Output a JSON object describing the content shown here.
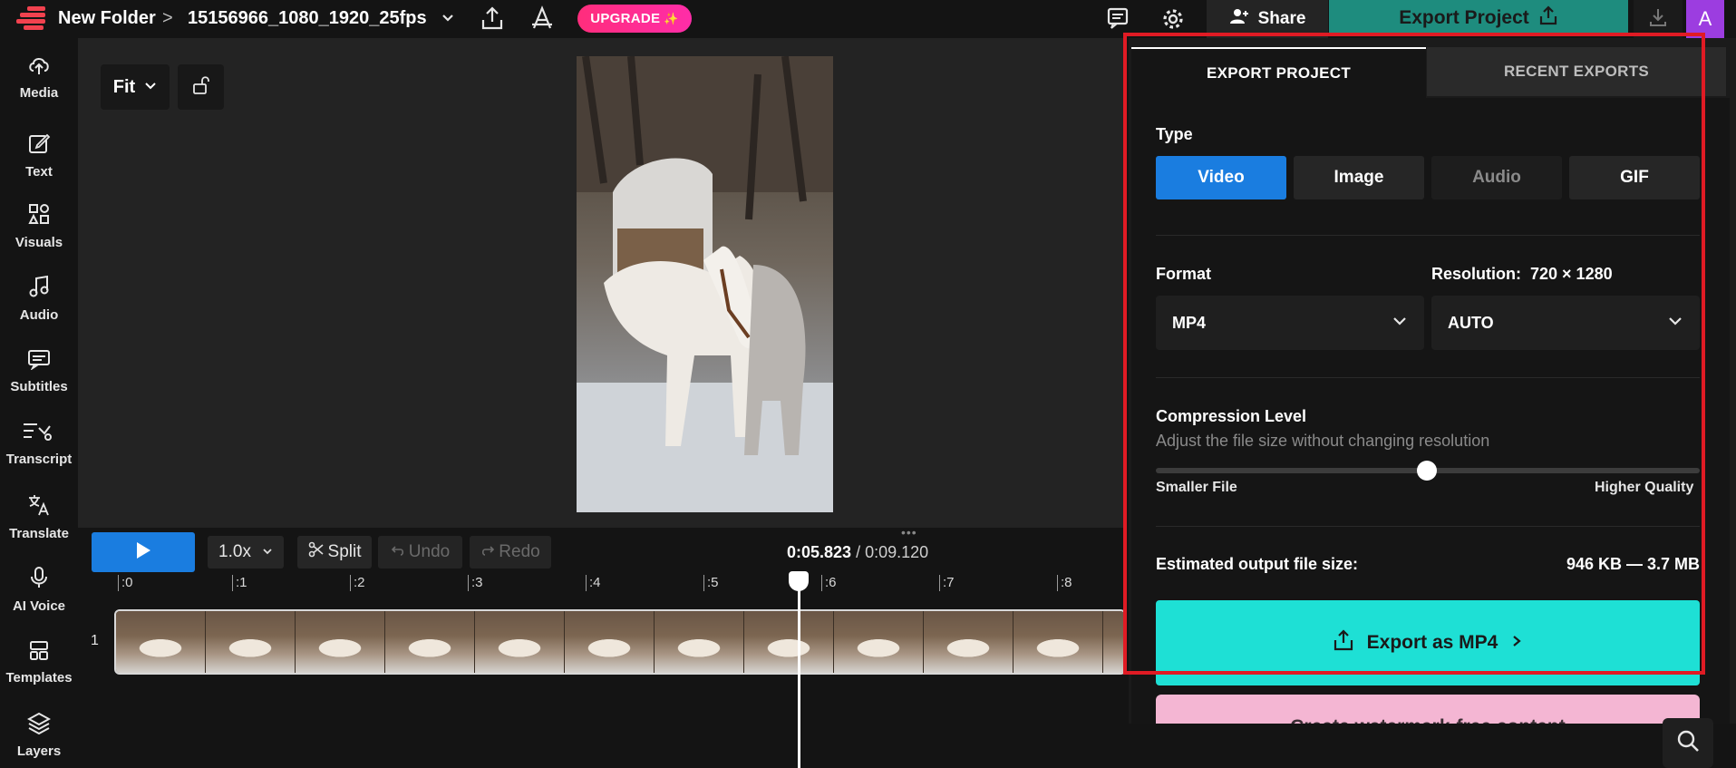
{
  "topbar": {
    "folder": "New Folder",
    "separator": ">",
    "project_name": "15156966_1080_1920_25fps",
    "upgrade_label": "UPGRADE",
    "upgrade_spark": "✨",
    "share_label": "Share",
    "export_label": "Export Project",
    "avatar_initial": "A"
  },
  "sidebar": {
    "items": [
      {
        "label": "Media",
        "icon": "cloud-upload-icon"
      },
      {
        "label": "Text",
        "icon": "edit-icon"
      },
      {
        "label": "Visuals",
        "icon": "shapes-icon"
      },
      {
        "label": "Audio",
        "icon": "music-icon"
      },
      {
        "label": "Subtitles",
        "icon": "subtitles-icon"
      },
      {
        "label": "Transcript",
        "icon": "transcript-icon"
      },
      {
        "label": "Translate",
        "icon": "translate-icon"
      },
      {
        "label": "AI Voice",
        "icon": "microphone-icon"
      },
      {
        "label": "Templates",
        "icon": "templates-icon"
      },
      {
        "label": "Layers",
        "icon": "layers-icon"
      }
    ]
  },
  "canvas": {
    "fit_label": "Fit"
  },
  "playback": {
    "speed": "1.0x",
    "split": "Split",
    "undo": "Undo",
    "redo": "Redo",
    "current_time": "0:05.823",
    "time_sep": " / ",
    "total_time": "0:09.120"
  },
  "timeline": {
    "ticks": [
      ":0",
      ":1",
      ":2",
      ":3",
      ":4",
      ":5",
      ":6",
      ":7",
      ":8"
    ],
    "track_number": "1"
  },
  "export_panel": {
    "tab_export": "EXPORT PROJECT",
    "tab_recent": "RECENT EXPORTS",
    "type_label": "Type",
    "types": [
      {
        "label": "Video",
        "selected": true
      },
      {
        "label": "Image",
        "selected": false
      },
      {
        "label": "Audio",
        "selected": false,
        "disabled": true
      },
      {
        "label": "GIF",
        "selected": false
      }
    ],
    "format_label": "Format",
    "format_value": "MP4",
    "resolution_label": "Resolution:",
    "resolution_value": "720 × 1280",
    "resolution_select": "AUTO",
    "compression_label": "Compression Level",
    "compression_sub": "Adjust the file size without changing resolution",
    "compression_level": 0.5,
    "smaller_label": "Smaller File",
    "higher_label": "Higher Quality",
    "estimate_label": "Estimated output file size:",
    "estimate_value": "946 KB — 3.7 MB",
    "export_button": "Export as MP4",
    "watermark_button": "Create watermark-free content"
  },
  "colors": {
    "accent_blue": "#1a7de0",
    "export_cyan": "#1ee0d5",
    "upgrade_pink": "#ff2d7c",
    "highlight_red": "#e01b24",
    "avatar_purple": "#9c3de0"
  }
}
